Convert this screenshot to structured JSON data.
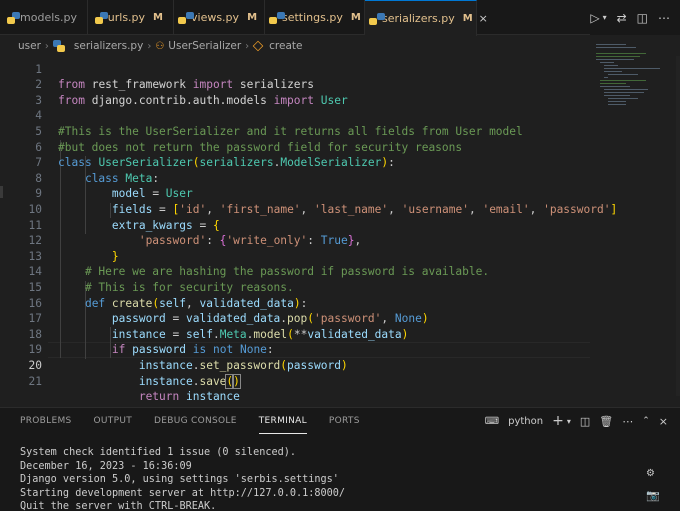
{
  "tabs": [
    {
      "name": "models.py",
      "modified": false,
      "active": false
    },
    {
      "name": "urls.py",
      "modified": true,
      "active": false
    },
    {
      "name": "views.py",
      "modified": true,
      "active": false
    },
    {
      "name": "settings.py",
      "modified": true,
      "active": false
    },
    {
      "name": "serializers.py",
      "modified": true,
      "active": true
    }
  ],
  "modified_marker": "M",
  "close_glyph": "×",
  "breadcrumb": {
    "folder": "user",
    "file": "serializers.py",
    "class": "UserSerializer",
    "method": "create"
  },
  "editor": {
    "current_line": 20,
    "lines": [
      {
        "n": "1"
      },
      {
        "n": "2"
      },
      {
        "n": "3"
      },
      {
        "n": "4"
      },
      {
        "n": "5"
      },
      {
        "n": "6"
      },
      {
        "n": "7"
      },
      {
        "n": "8"
      },
      {
        "n": "9"
      },
      {
        "n": "10"
      },
      {
        "n": "11"
      },
      {
        "n": "12"
      },
      {
        "n": "13"
      },
      {
        "n": "14"
      },
      {
        "n": "15"
      },
      {
        "n": "16"
      },
      {
        "n": "17"
      },
      {
        "n": "18"
      },
      {
        "n": "19"
      },
      {
        "n": "20"
      },
      {
        "n": "21"
      }
    ],
    "tokens": {
      "from": "from",
      "import": "import",
      "mod1": "rest_framework",
      "name1": "serializers",
      "mod2": "django.contrib.auth.models",
      "name2": "User",
      "cmt1": "#This is the UserSerializer and it returns all fields from User model",
      "cmt2": "#but does not return the password field for security reasons",
      "class": "class",
      "cls_name": "UserSerializer",
      "base_mod": "serializers",
      "base_cls": "ModelSerializer",
      "meta": "Meta",
      "model": "model",
      "user": "User",
      "fields": "fields",
      "f_id": "'id'",
      "f_first": "'first_name'",
      "f_last": "'last_name'",
      "f_user": "'username'",
      "f_email": "'email'",
      "f_pass": "'password'",
      "extra": "extra_kwargs",
      "k_pass": "'password'",
      "k_wo": "'write_only'",
      "true": "True",
      "cmt3": "# Here we are hashing the password if password is available.",
      "cmt4": "# This is for security reasons.",
      "def": "def",
      "create": "create",
      "self": "self",
      "vd": "validated_data",
      "password": "password",
      "pop": "pop",
      "none": "None",
      "instance": "instance",
      "meta2": "Meta",
      "model2": "model",
      "if": "if",
      "is": "is",
      "not": "not",
      "set_password": "set_password",
      "save": "save",
      "return": "return"
    }
  },
  "panel": {
    "tabs": [
      "PROBLEMS",
      "OUTPUT",
      "DEBUG CONSOLE",
      "TERMINAL",
      "PORTS"
    ],
    "active_tab": "TERMINAL",
    "terminal_name": "python",
    "terminal_lines": [
      "System check identified 1 issue (0 silenced).",
      "December 16, 2023 - 16:36:09",
      "Django version 5.0, using settings 'serbis.settings'",
      "Starting development server at http://127.0.0.1:8000/",
      "Quit the server with CTRL-BREAK."
    ]
  }
}
